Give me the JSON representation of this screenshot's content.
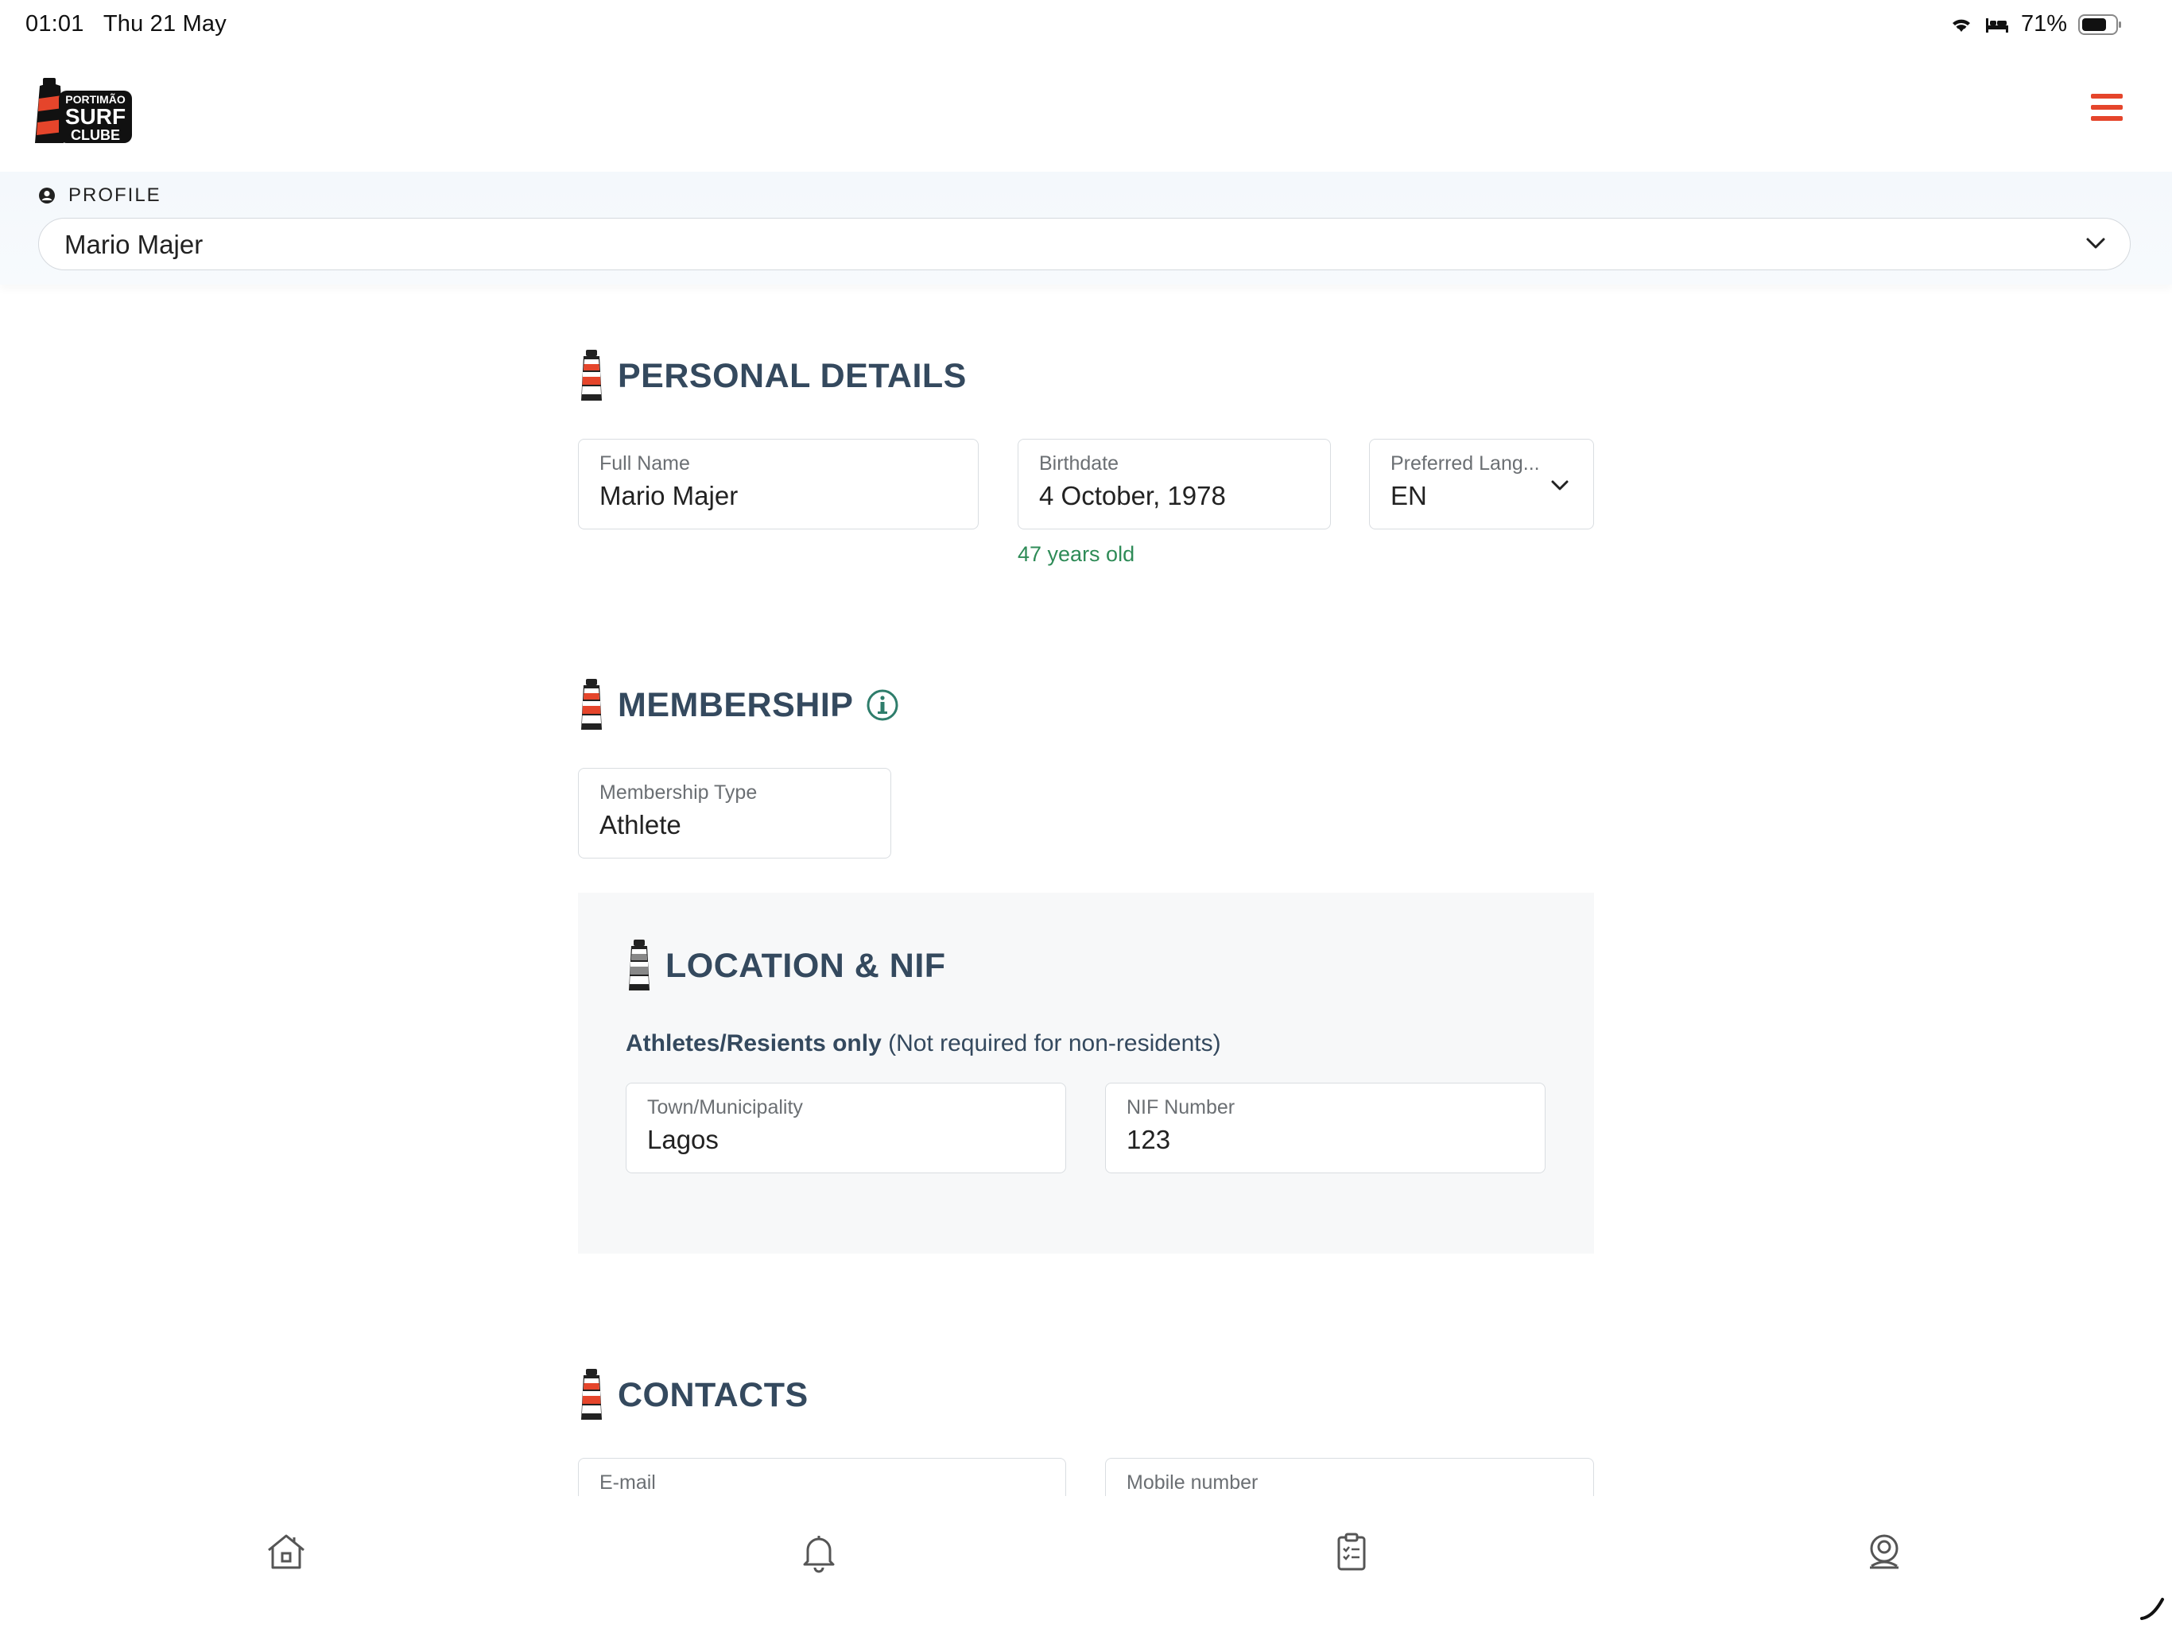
{
  "status_bar": {
    "time": "01:01",
    "date": "Thu 21 May",
    "battery": "71%"
  },
  "header": {
    "logo_text_top": "PORTIMÃO",
    "logo_text_mid": "SURF",
    "logo_text_bot": "CLUBE",
    "menu_icon": "hamburger-icon"
  },
  "profile": {
    "label": "PROFILE",
    "selected": "Mario Majer"
  },
  "personal_details": {
    "title": "PERSONAL DETAILS",
    "full_name_label": "Full Name",
    "full_name": "Mario Majer",
    "birthdate_label": "Birthdate",
    "birthdate": "4 October, 1978",
    "age_hint": "47 years old",
    "language_label": "Preferred Lang...",
    "language": "EN"
  },
  "membership": {
    "title": "MEMBERSHIP",
    "type_label": "Membership Type",
    "type": "Athlete"
  },
  "location": {
    "title": "LOCATION & NIF",
    "note_bold": "Athletes/Resients only",
    "note_rest": "(Not required for non-residents)",
    "town_label": "Town/Municipality",
    "town": "Lagos",
    "nif_label": "NIF Number",
    "nif": "123"
  },
  "contacts": {
    "title": "CONTACTS",
    "email_label": "E-mail",
    "mobile_label": "Mobile number"
  },
  "colors": {
    "accent": "#e5452b",
    "heading": "#34495e",
    "success": "#2e8b57"
  },
  "tabbar": {
    "items": [
      "home-icon",
      "bell-icon",
      "clipboard-icon",
      "support-icon"
    ]
  }
}
